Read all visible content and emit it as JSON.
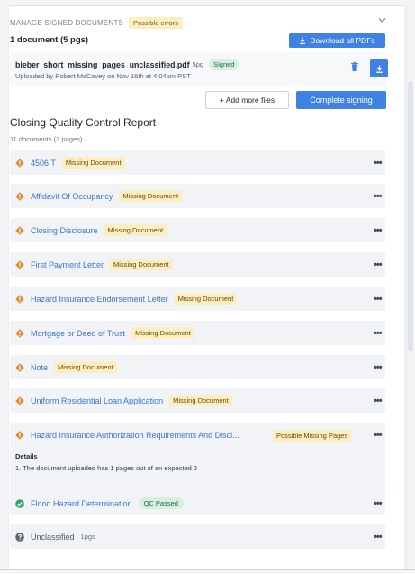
{
  "header": {
    "title": "MANAGE SIGNED DOCUMENTS",
    "badge": "Possible errors",
    "count_label": "1 document (5 pgs)",
    "download_all_label": "Download all PDFs"
  },
  "file": {
    "name": "bieber_short_missing_pages_unclassified.pdf",
    "pages": "5pg",
    "status": "Signed",
    "uploaded": "Uploaded by Robert McCovey on Nov 16th at 4:04pm PST"
  },
  "actions": {
    "add_files": "+ Add more files",
    "complete": "Complete signing"
  },
  "report": {
    "title": "Closing Quality Control Report",
    "subtitle": "11 documents (3 pages)",
    "items": [
      {
        "label": "4506 T",
        "badge": "Missing Document",
        "status": "warning"
      },
      {
        "label": "Affidavit Of Occupancy",
        "badge": "Missing Document",
        "status": "warning"
      },
      {
        "label": "Closing Disclosure",
        "badge": "Missing Document",
        "status": "warning"
      },
      {
        "label": "First Payment Letter",
        "badge": "Missing Document",
        "status": "warning"
      },
      {
        "label": "Hazard Insurance Endorsement Letter",
        "badge": "Missing Document",
        "status": "warning"
      },
      {
        "label": "Mortgage or Deed of Trust",
        "badge": "Missing Document",
        "status": "warning"
      },
      {
        "label": "Note",
        "badge": "Missing Document",
        "status": "warning"
      },
      {
        "label": "Uniform Residential Loan Application",
        "badge": "Missing Document",
        "status": "warning"
      },
      {
        "label": "Hazard Insurance Authorization Requirements And Discl...",
        "badge": "Possible Missing Pages",
        "status": "warning",
        "details_heading": "Details",
        "details_text": "1. The document uploaded has 1 pages out of an expected 2"
      },
      {
        "label": "Flood Hazard Determination",
        "badge": "QC Passed",
        "status": "passed"
      },
      {
        "label": "Unclassified",
        "pages": "1pgs",
        "status": "unknown"
      }
    ]
  },
  "more_glyph": "•••",
  "colors": {
    "accent": "#3f82e4",
    "warning": "#e0892c",
    "passed": "#2fa46e",
    "unknown": "#5d6472"
  },
  "icons": {
    "warning": "diamond-warning-icon",
    "passed": "check-circle-icon",
    "unknown": "question-circle-icon",
    "download": "download-icon",
    "trash": "trash-icon",
    "chevron": "chevron-down-icon",
    "more": "more-dots-icon"
  }
}
